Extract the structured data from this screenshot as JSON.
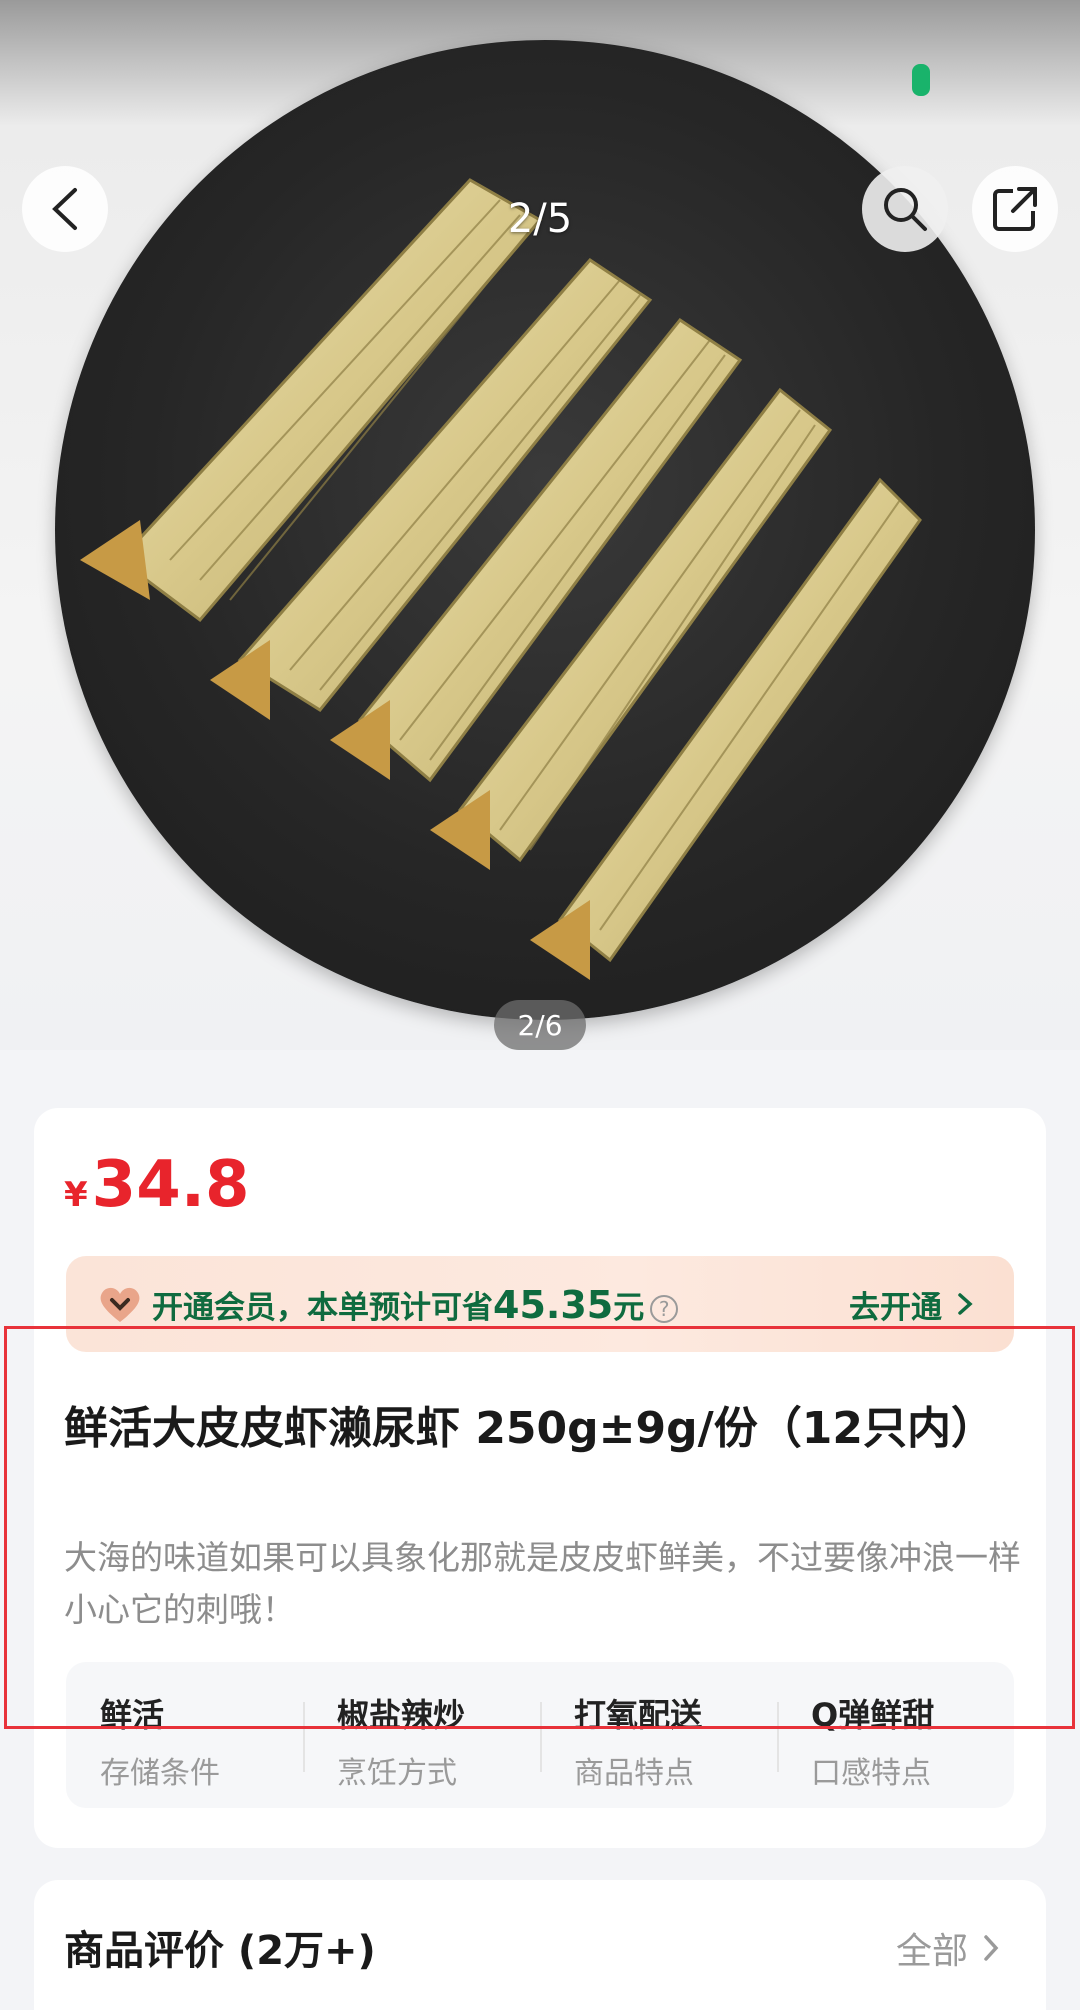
{
  "gallery": {
    "counter_top": "2/5",
    "counter_bottom": "2/6"
  },
  "product": {
    "currency": "¥",
    "price": "34.8",
    "member": {
      "text": "开通会员，本单预计可省",
      "amount": "45.35",
      "unit": "元",
      "help": "?",
      "cta": "去开通"
    },
    "title": "鲜活大皮皮虾濑尿虾 250g±9g/份（12只内）",
    "subtitle": "大海的味道如果可以具象化那就是皮皮虾鲜美，不过要像冲浪一样小心它的刺哦！",
    "attributes": [
      {
        "value": "鲜活",
        "label": "存储条件"
      },
      {
        "value": "椒盐辣炒",
        "label": "烹饪方式"
      },
      {
        "value": "打氧配送",
        "label": "商品特点"
      },
      {
        "value": "Q弹鲜甜",
        "label": "口感特点"
      }
    ]
  },
  "reviews": {
    "title": "商品评价 (2万+)",
    "all_label": "全部"
  },
  "colors": {
    "price_red": "#e8242c",
    "member_green": "#0f6b3f",
    "highlight_red": "#e8323a"
  }
}
